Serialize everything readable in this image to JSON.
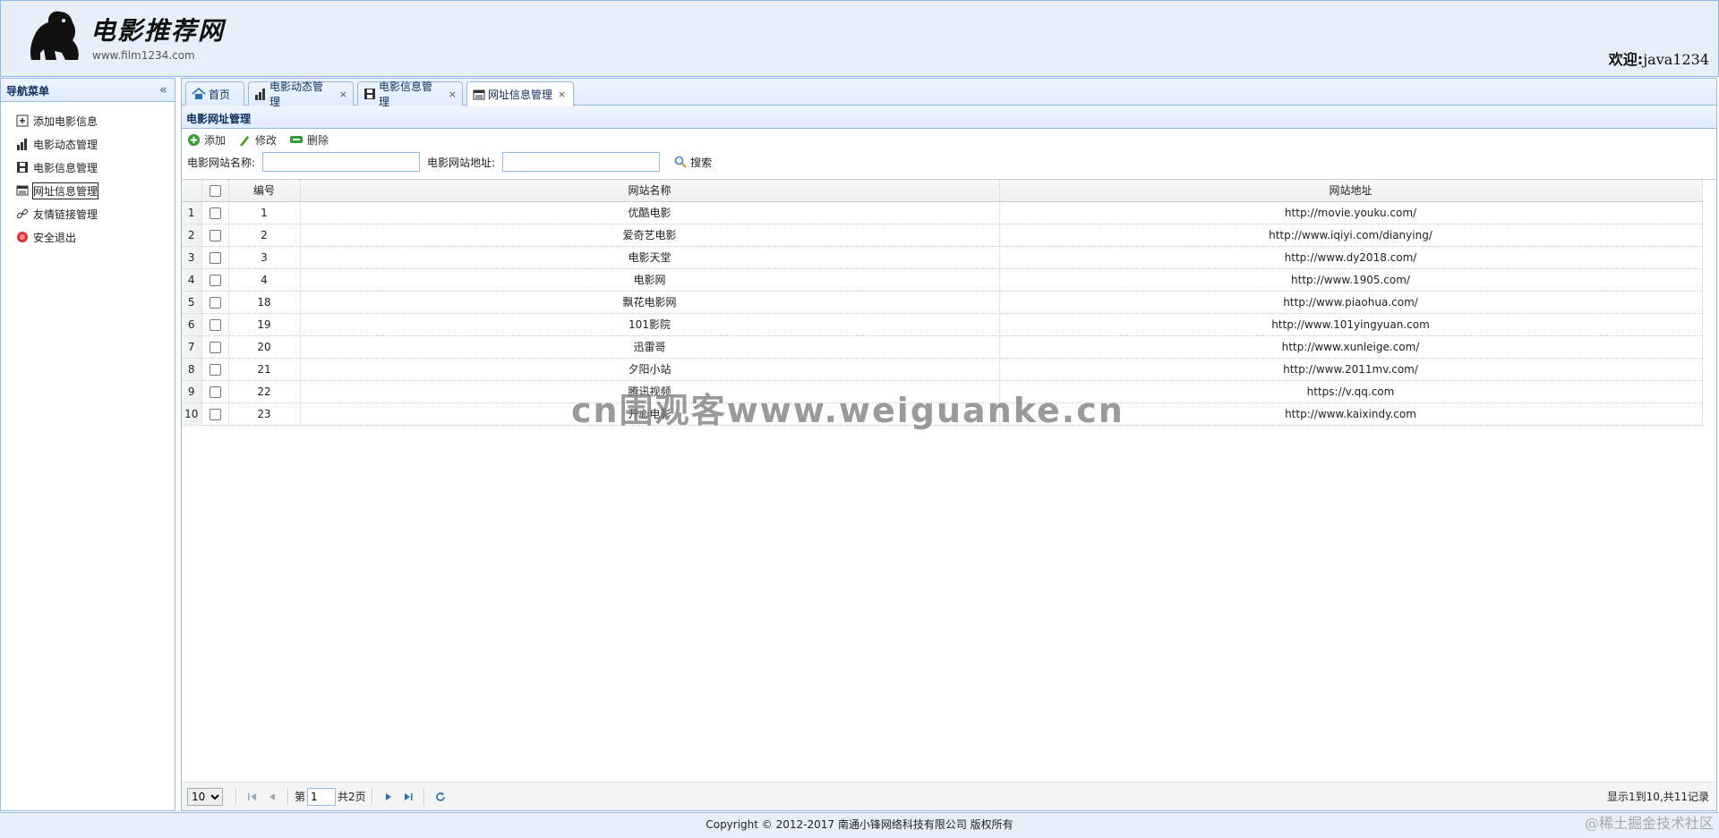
{
  "header": {
    "logo_title": "电影推荐网",
    "logo_url": "www.film1234.com",
    "welcome_label": "欢迎:",
    "username": "java1234"
  },
  "nav": {
    "title": "导航菜单",
    "items": [
      {
        "label": "添加电影信息",
        "icon": "add-icon"
      },
      {
        "label": "电影动态管理",
        "icon": "chart-icon"
      },
      {
        "label": "电影信息管理",
        "icon": "film-icon"
      },
      {
        "label": "网址信息管理",
        "icon": "web-icon"
      },
      {
        "label": "友情链接管理",
        "icon": "link-icon"
      },
      {
        "label": "安全退出",
        "icon": "exit-icon"
      }
    ]
  },
  "tabs": [
    {
      "label": "首页",
      "icon": "home-icon",
      "closable": false
    },
    {
      "label": "电影动态管理",
      "icon": "chart-icon",
      "closable": true
    },
    {
      "label": "电影信息管理",
      "icon": "film-icon",
      "closable": true
    },
    {
      "label": "网址信息管理",
      "icon": "web-icon",
      "closable": true,
      "active": true
    }
  ],
  "panel": {
    "title": "电影网址管理"
  },
  "toolbar": {
    "add_label": "添加",
    "edit_label": "修改",
    "delete_label": "删除"
  },
  "search": {
    "name_label": "电影网站名称:",
    "url_label": "电影网站地址:",
    "name_value": "",
    "url_value": "",
    "button_label": "搜索"
  },
  "grid": {
    "headers": {
      "id": "编号",
      "name": "网站名称",
      "url": "网站地址"
    },
    "rows": [
      {
        "n": "1",
        "id": "1",
        "name": "优酷电影",
        "url": "http://movie.youku.com/"
      },
      {
        "n": "2",
        "id": "2",
        "name": "爱奇艺电影",
        "url": "http://www.iqiyi.com/dianying/"
      },
      {
        "n": "3",
        "id": "3",
        "name": "电影天堂",
        "url": "http://www.dy2018.com/"
      },
      {
        "n": "4",
        "id": "4",
        "name": "电影网",
        "url": "http://www.1905.com/"
      },
      {
        "n": "5",
        "id": "18",
        "name": "飘花电影网",
        "url": "http://www.piaohua.com/"
      },
      {
        "n": "6",
        "id": "19",
        "name": "101影院",
        "url": "http://www.101yingyuan.com"
      },
      {
        "n": "7",
        "id": "20",
        "name": "迅雷哥",
        "url": "http://www.xunleige.com/"
      },
      {
        "n": "8",
        "id": "21",
        "name": "夕阳小站",
        "url": "http://www.2011mv.com/"
      },
      {
        "n": "9",
        "id": "22",
        "name": "腾讯视频",
        "url": "https://v.qq.com"
      },
      {
        "n": "10",
        "id": "23",
        "name": "开心电影",
        "url": "http://www.kaixindy.com"
      }
    ]
  },
  "pager": {
    "page_size": "10",
    "page_prefix": "第",
    "page_value": "1",
    "page_total": "共2页",
    "info": "显示1到10,共11记录"
  },
  "footer": {
    "copyright": "Copyright © 2012-2017 南通小锋网络科技有限公司 版权所有"
  },
  "watermark": "cn围观客www.weiguanke.cn",
  "corner_mark": "@稀土掘金技术社区"
}
